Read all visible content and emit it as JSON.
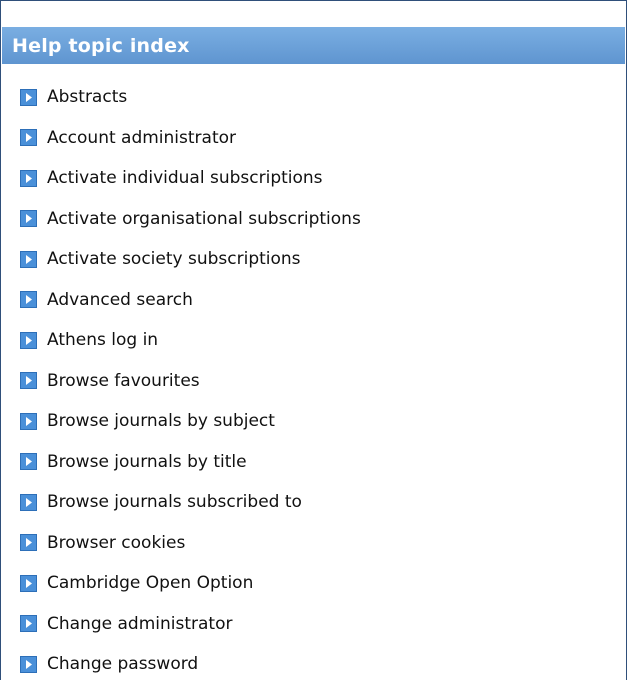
{
  "panel": {
    "title": "Help topic index"
  },
  "topics": [
    {
      "label": "Abstracts",
      "icon": "arrow-right-icon"
    },
    {
      "label": "Account administrator",
      "icon": "arrow-right-icon"
    },
    {
      "label": "Activate individual subscriptions",
      "icon": "arrow-right-icon"
    },
    {
      "label": "Activate organisational subscriptions",
      "icon": "arrow-right-icon"
    },
    {
      "label": "Activate society subscriptions",
      "icon": "arrow-right-icon"
    },
    {
      "label": "Advanced search",
      "icon": "arrow-right-icon"
    },
    {
      "label": "Athens log in",
      "icon": "arrow-right-icon"
    },
    {
      "label": "Browse favourites",
      "icon": "arrow-right-icon"
    },
    {
      "label": "Browse journals by subject",
      "icon": "arrow-right-icon"
    },
    {
      "label": "Browse journals by title",
      "icon": "arrow-right-icon"
    },
    {
      "label": "Browse journals subscribed to",
      "icon": "arrow-right-icon"
    },
    {
      "label": "Browser cookies",
      "icon": "arrow-right-icon"
    },
    {
      "label": "Cambridge Open Option",
      "icon": "arrow-right-icon"
    },
    {
      "label": "Change administrator",
      "icon": "arrow-right-icon"
    },
    {
      "label": "Change password",
      "icon": "arrow-right-icon"
    }
  ],
  "colors": {
    "header_bg": "#6a9fd8",
    "header_text": "#ffffff",
    "icon_bg": "#4a90d9",
    "link_text": "#111111",
    "border": "#2f4f7a"
  }
}
